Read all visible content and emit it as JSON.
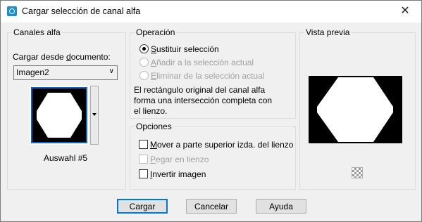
{
  "window": {
    "title": "Cargar selección de canal alfa",
    "close_symbol": "✕"
  },
  "canales": {
    "legend": "Canales alfa",
    "load_label_pre": "Cargar desde ",
    "load_label_ul": "d",
    "load_label_post": "ocumento:",
    "document_value": "Imagen2",
    "channel_name": "Auswahl #5"
  },
  "operacion": {
    "legend": "Operación",
    "options": [
      {
        "ul": "S",
        "rest": "ustituir selección",
        "selected": true,
        "enabled": true
      },
      {
        "ul": "A",
        "rest": "ñadir a la selección actual",
        "selected": false,
        "enabled": false
      },
      {
        "ul": "E",
        "rest": "liminar de la selección actual",
        "selected": false,
        "enabled": false
      }
    ],
    "description": [
      "El rectángulo original del canal alfa",
      "forma una intersección completa con",
      "el lienzo."
    ]
  },
  "opciones": {
    "legend": "Opciones",
    "items": [
      {
        "ul": "M",
        "rest": "over a parte superior izda. del lienzo",
        "checked": false,
        "enabled": true
      },
      {
        "ul": "P",
        "rest": "egar en lienzo",
        "checked": false,
        "enabled": false
      },
      {
        "ul": "I",
        "rest": "nvertir imagen",
        "checked": false,
        "enabled": true
      }
    ]
  },
  "preview": {
    "legend": "Vista previa"
  },
  "buttons": {
    "ok": "Cargar",
    "cancel": "Cancelar",
    "help": "Ayuda"
  },
  "colors": {
    "accent": "#0078d7",
    "selection_border": "#0a64c8"
  }
}
